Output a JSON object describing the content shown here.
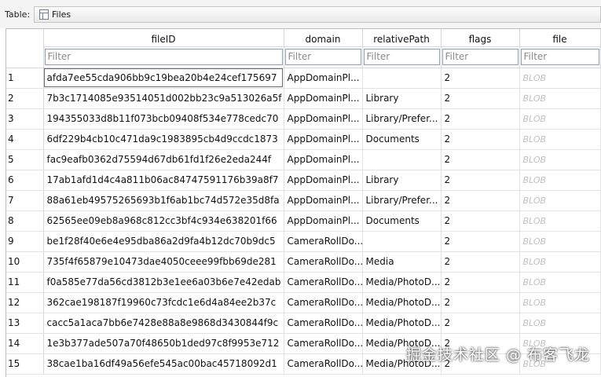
{
  "toolbar": {
    "table_label": "Table:",
    "table_name": "Files",
    "table_icon": "table-icon"
  },
  "columns": [
    "fileID",
    "domain",
    "relativePath",
    "flags",
    "file"
  ],
  "filter_placeholder": "Filter",
  "rows": [
    {
      "n": "1",
      "fileID": "afda7ee55cda906bb9c19bea20b4e24cef175697",
      "domain": "AppDomainPl...",
      "relativePath": "",
      "flags": "2",
      "file": "BLOB"
    },
    {
      "n": "2",
      "fileID": "7b3c1714085e93514051d002bb23c9a513026a5f",
      "domain": "AppDomainPl...",
      "relativePath": "Library",
      "flags": "2",
      "file": "BLOB"
    },
    {
      "n": "3",
      "fileID": "194355033d8b11f073bcb09408f534e778cedc70",
      "domain": "AppDomainPl...",
      "relativePath": "Library/Prefer...",
      "flags": "2",
      "file": "BLOB"
    },
    {
      "n": "4",
      "fileID": "6df229b4cb10c471da9c1983895cb4d9ccdc1873",
      "domain": "AppDomainPl...",
      "relativePath": "Documents",
      "flags": "2",
      "file": "BLOB"
    },
    {
      "n": "5",
      "fileID": "fac9eafb0362d75594d67db61fd1f26e2eda244f",
      "domain": "AppDomainPl...",
      "relativePath": "",
      "flags": "2",
      "file": "BLOB"
    },
    {
      "n": "6",
      "fileID": "17ab1afd1d4c4a811b06ac84747591176b39a8f7",
      "domain": "AppDomainPl...",
      "relativePath": "Library",
      "flags": "2",
      "file": "BLOB"
    },
    {
      "n": "7",
      "fileID": "88a61eb49575265693b1f6ab1bc74d572e35d8fa",
      "domain": "AppDomainPl...",
      "relativePath": "Library/Prefer...",
      "flags": "2",
      "file": "BLOB"
    },
    {
      "n": "8",
      "fileID": "62565ee09eb8a968c812cc3bf4c934e638201f66",
      "domain": "AppDomainPl...",
      "relativePath": "Documents",
      "flags": "2",
      "file": "BLOB"
    },
    {
      "n": "9",
      "fileID": "be1f28f40e6e4e95dba86a2d9fa4b12dc70b9dc5",
      "domain": "CameraRollDo...",
      "relativePath": "",
      "flags": "2",
      "file": "BLOB"
    },
    {
      "n": "10",
      "fileID": "735f4f65879e10473dae4050ceee99fbb69de281",
      "domain": "CameraRollDo...",
      "relativePath": "Media",
      "flags": "2",
      "file": "BLOB"
    },
    {
      "n": "11",
      "fileID": "f0a585e77da56cd3812b3e1ee6a03b6e7e42edab",
      "domain": "CameraRollDo...",
      "relativePath": "Media/PhotoD...",
      "flags": "2",
      "file": "BLOB"
    },
    {
      "n": "12",
      "fileID": "362cae198187f19960c73fcdc1e6d4a84ee2b37c",
      "domain": "CameraRollDo...",
      "relativePath": "Media/PhotoD...",
      "flags": "2",
      "file": "BLOB"
    },
    {
      "n": "13",
      "fileID": "cacc5a1aca7bb6e7428e88a8e9868d3430844f9c",
      "domain": "CameraRollDo...",
      "relativePath": "Media/PhotoD...",
      "flags": "2",
      "file": "BLOB"
    },
    {
      "n": "14",
      "fileID": "1e3b377ade507a70f48650b1ded97c8f9953e712",
      "domain": "CameraRollDo...",
      "relativePath": "Media/PhotoD...",
      "flags": "2",
      "file": "BLOB"
    },
    {
      "n": "15",
      "fileID": "38cae1ba16df49a56efe545ac00bac45718092d1",
      "domain": "CameraRollDo...",
      "relativePath": "Media/PhotoD...",
      "flags": "2",
      "file": "BLOB"
    }
  ],
  "selected_row": "1",
  "watermark": "掘金技术社区 @ 布客飞龙",
  "colors": {
    "toolbar_bg": "#f4f4f4",
    "blob_text": "#c0c0c0",
    "grid_line": "#e3e3e3",
    "filter_border": "#8e9fb3"
  }
}
